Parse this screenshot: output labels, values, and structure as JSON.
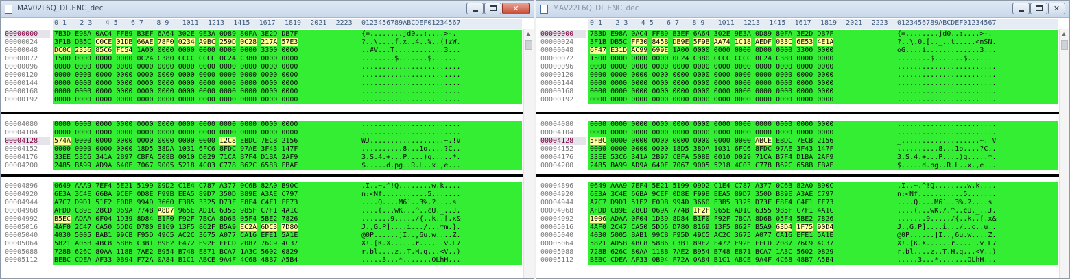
{
  "left": {
    "title": "MAV02L6Q_DL.ENC_dec",
    "rows": [
      {
        "addr": "00000000",
        "hex": "7B3D E98A 0AC4 FFB9 B3EF 6A64 302E 9E3A 0D89 80FA 3E2D DB7F",
        "ascii": "{=........jd0..:....>-."
      },
      {
        "addr": "00000024",
        "hex": "3F1B DB5C C0CE 01DB 66AE 78F0 0234 A9BC 259D 0C28 217A 57E3",
        "ascii": "?..\\....f.x..4..%..(!zW."
      },
      {
        "addr": "00000048",
        "hex": "DC0C 2356 85C6 FC54 1A00 0000 0000 0000 0D00 0000 3300 0000",
        "ascii": "..#V...T............3..."
      },
      {
        "addr": "00000072",
        "hex": "1500 0000 0000 0000 0C24 C380 CCCC CCCC 0C24 C380 0000 0000",
        "ascii": "........$.......$......"
      },
      {
        "addr": "00000096",
        "hex": "0000 0000 0000 0000 0000 0000 0000 0000 0000 0000 0000 0000",
        "ascii": "........................"
      },
      {
        "addr": "00000120",
        "hex": "0000 0000 0000 0000 0000 0000 0000 0000 0000 0000 0000 0000",
        "ascii": "........................"
      },
      {
        "addr": "00000144",
        "hex": "0000 0000 0000 0000 0000 0000 0000 0000 0000 0000 0000 0000",
        "ascii": "........................"
      },
      {
        "addr": "00000168",
        "hex": "0000 0000 0000 0000 0000 0000 0000 0000 0000 0000 0000 0000",
        "ascii": "........................"
      },
      {
        "addr": "00000192",
        "hex": "0000 0000 0000 0000 0000 0000 0000 0000 0000 0000 0000 0000",
        "ascii": "........................"
      },
      {
        "addr": "00004080",
        "hex": "0000 0000 0000 0000 0000 0000 0000 0000 0000 0000 0000 0000",
        "ascii": "........................"
      },
      {
        "addr": "00004104",
        "hex": "0000 0000 0000 0000 0000 0000 0000 0000 0000 0000 0000 0000",
        "ascii": "........................"
      },
      {
        "addr": "00004128",
        "hex": "574A 0000 0000 0000 0000 0000 0000 0000 12C8 EBDC 7ECB 2156",
        "ascii": "WJ..................~.!V"
      },
      {
        "addr": "00004152",
        "hex": "0000 0000 0000 0000 18D5 38DA 1031 6FC6 8FDC 97AE 3F43 147F",
        "ascii": "..........8...1o....?C.."
      },
      {
        "addr": "00004176",
        "hex": "33EE 53C6 341A 2B97 CBFA 508B 0010 D029 71CA B7F4 D1BA 2AF9",
        "ascii": "3.S.4.+...P....)q.....*."
      },
      {
        "addr": "00004200",
        "hex": "2485 BA99 AD9A 640E 7067 9005 5218 4C03 C778 B62C 658B FBAE",
        "ascii": "$.....d.pg..R.L..x.,e..."
      },
      {
        "addr": "00004896",
        "hex": "0649 AAA9 7EF4 5E21 5199 09D2 C1E4 C787 A377 0C6B 82A0 B90C",
        "ascii": ".I..~.^!Q........w.k...."
      },
      {
        "addr": "00004920",
        "hex": "6E3A 3C4E 66BA 9CEF 0D8E F99B EEA5 89D7 350D B89E A3AE C797",
        "ascii": "n:<Nf...........5......."
      },
      {
        "addr": "00004944",
        "hex": "A7C7 D9D1 51E2 E0DB 994D 3660 F3B5 3325 D73F E8F4 C4F1 FF73",
        "ascii": "....Q....M6`..3%.?....s"
      },
      {
        "addr": "00004968",
        "hex": "AFDD C89E 28CD 069A 774B A8D7 965E AD1C 6355 985F C7F1 4A1C",
        "ascii": "....(...wK...^..cU._..J."
      },
      {
        "addr": "00004992",
        "hex": "B5EC ADAA 0F04 1D39 8D84 B1F0 F92F 7BCA 8D6B 05F4 5BE2 7826",
        "ascii": ".......9...../{..k..[.x&"
      },
      {
        "addr": "00005016",
        "hex": "4AF0 2C47 CA50 5DD6 D780 8169 13F5 862F B5A9 EC2A 6DC3 7D80",
        "ascii": "J.,G.P]....i.../...*m.}."
      },
      {
        "addr": "00005040",
        "hex": "4030 5005 BAB1 99CB F95D 49C5 AC2C 3675 A077 CA16 EFE1 5A1E",
        "ascii": "@0P......]I..,6u.w....Z."
      },
      {
        "addr": "00005064",
        "hex": "5821 A05B 4BC8 58B6 C3B1 89E2 F472 E92E FFCD 2087 76C9 4C37",
        "ascii": "X!.[K.X......r.... .v.L7"
      },
      {
        "addr": "00005088",
        "hex": "728B 626C 80AA 118B 7AE2 B954 B748 E871 BCA7 1A3C 5602 0829",
        "ascii": "r.bl....z..T.H.q...<V..)"
      },
      {
        "addr": "00005112",
        "hex": "BEBC CDEA AF33 0B94 F72A 0A84 B1C1 ABCE 9A4F 4C68 48B7 A5B4",
        "ascii": ".....3...*.......OLhH..."
      }
    ]
  },
  "right": {
    "title": "MAV22L6Q_DL.ENC_dec",
    "rows": [
      {
        "addr": "00000000",
        "hex": "7B3D E98A 0AC4 FFB9 B3EF 6A64 302E 9E3A 0D89 80FA 3E2D DB7F",
        "ascii": "{=........jd0..:....>-."
      },
      {
        "addr": "00000024",
        "hex": "3F1B DB5C FF30 845B DB9E 5F9B AA74 1C18 AEDF 033C 6E53 4E1A",
        "ascii": "?..\\.0.[.._..t.....<nSN."
      },
      {
        "addr": "00000048",
        "hex": "6F47 E31D AC99 699E 1A00 0000 0000 0000 0D00 0000 3300 0000",
        "ascii": "oG....i.............3..."
      },
      {
        "addr": "00000072",
        "hex": "1500 0000 0000 0000 0C24 C380 CCCC CCCC 0C24 C380 0000 0000",
        "ascii": "........$.......$......"
      },
      {
        "addr": "00000096",
        "hex": "0000 0000 0000 0000 0000 0000 0000 0000 0000 0000 0000 0000",
        "ascii": "........................"
      },
      {
        "addr": "00000120",
        "hex": "0000 0000 0000 0000 0000 0000 0000 0000 0000 0000 0000 0000",
        "ascii": "........................"
      },
      {
        "addr": "00000144",
        "hex": "0000 0000 0000 0000 0000 0000 0000 0000 0000 0000 0000 0000",
        "ascii": "........................"
      },
      {
        "addr": "00000168",
        "hex": "0000 0000 0000 0000 0000 0000 0000 0000 0000 0000 0000 0000",
        "ascii": "........................"
      },
      {
        "addr": "00000192",
        "hex": "0000 0000 0000 0000 0000 0000 0000 0000 0000 0000 0000 0000",
        "ascii": "........................"
      },
      {
        "addr": "00004080",
        "hex": "0000 0000 0000 0000 0000 0000 0000 0000 0000 0000 0000 0000",
        "ascii": "........................"
      },
      {
        "addr": "00004104",
        "hex": "0000 0000 0000 0000 0000 0000 0000 0000 0000 0000 0000 0000",
        "ascii": "........................"
      },
      {
        "addr": "00004128",
        "hex": "5FBC 0000 0000 0000 0000 0000 0000 0000 ABCE EBDC 7ECB 2156",
        "ascii": "_...................~.!V"
      },
      {
        "addr": "00004152",
        "hex": "0000 0000 0000 0000 18D5 38DA 1031 6FC6 8FDC 97AE 3F43 147F",
        "ascii": "..........8...1o....?C.."
      },
      {
        "addr": "00004176",
        "hex": "33EE 53C6 341A 2B97 CBFA 508B 0010 D029 71CA B7F4 D1BA 2AF9",
        "ascii": "3.S.4.+...P....)q.....*."
      },
      {
        "addr": "00004200",
        "hex": "2485 BA99 AD9A 640E 7067 9005 5218 4C03 C778 B62C 658B FBAE",
        "ascii": "$.....d.pg..R.L..x.,e..."
      },
      {
        "addr": "00004896",
        "hex": "0649 AAA9 7EF4 5E21 5199 09D2 C1E4 C787 A377 0C6B 82A0 B90C",
        "ascii": ".I..~.^!Q........w.k...."
      },
      {
        "addr": "00004920",
        "hex": "6E3A 3C4E 66BA 9CEF 0D8E F99B EEA5 89D7 350D B89E A3AE C797",
        "ascii": "n:<Nf...........5......."
      },
      {
        "addr": "00004944",
        "hex": "A7C7 D9D1 51E2 E0DB 994D 3660 F3B5 3325 D73F E8F4 C4F1 FF73",
        "ascii": "....Q....M6`..3%.?....s"
      },
      {
        "addr": "00004968",
        "hex": "AFDD C89E 28CD 069A 774B 1F2F 965E AD1C 6355 985F C7F1 4A1C",
        "ascii": "....(...wK./.^..cU._..J."
      },
      {
        "addr": "00004992",
        "hex": "1006 ADAA 0F04 1D39 8D84 B1F0 F92F 7BCA 8D6B 05F4 5BE2 7826",
        "ascii": ".......9...../{..k..[.x&"
      },
      {
        "addr": "00005016",
        "hex": "4AF0 2C47 CA50 5DD6 D780 8169 13F5 862F B5A9 63D4 1F75 90D4",
        "ascii": "J.,G.P]....i.../..c..u.."
      },
      {
        "addr": "00005040",
        "hex": "4030 5005 BAB1 99CB F95D 49C5 AC2C 3675 A077 CA16 EFE1 5A1E",
        "ascii": "@0P......]I..,6u.w....Z."
      },
      {
        "addr": "00005064",
        "hex": "5821 A05B 4BC8 58B6 C3B1 89E2 F472 E92E FFCD 2087 76C9 4C37",
        "ascii": "X!.[K.X......r.... .v.L7"
      },
      {
        "addr": "00005088",
        "hex": "728B 626C 80AA 118B 7AE2 B954 B748 E871 BCA7 1A3C 5602 0829",
        "ascii": "r.bl....z..T.H.q...<V..)"
      },
      {
        "addr": "00005112",
        "hex": "BEBC CDEA AF33 0B94 F72A 0A84 B1C1 ABCE 9A4F 4C68 48B7 A5B4",
        "ascii": ".....3...*.......OLhH..."
      }
    ]
  },
  "column_header": {
    "hex": [
      "0 1",
      "2 3",
      "4 5",
      "6 7",
      "8 9",
      "1011",
      "1213",
      "1415",
      "1617",
      "1819",
      "2021",
      "2223"
    ],
    "ascii": "0123456789ABCDEF01234567"
  },
  "colors": {
    "match_green": "#33ee33",
    "diff_yellow": "#ffff99",
    "selected_address": "#800040"
  }
}
